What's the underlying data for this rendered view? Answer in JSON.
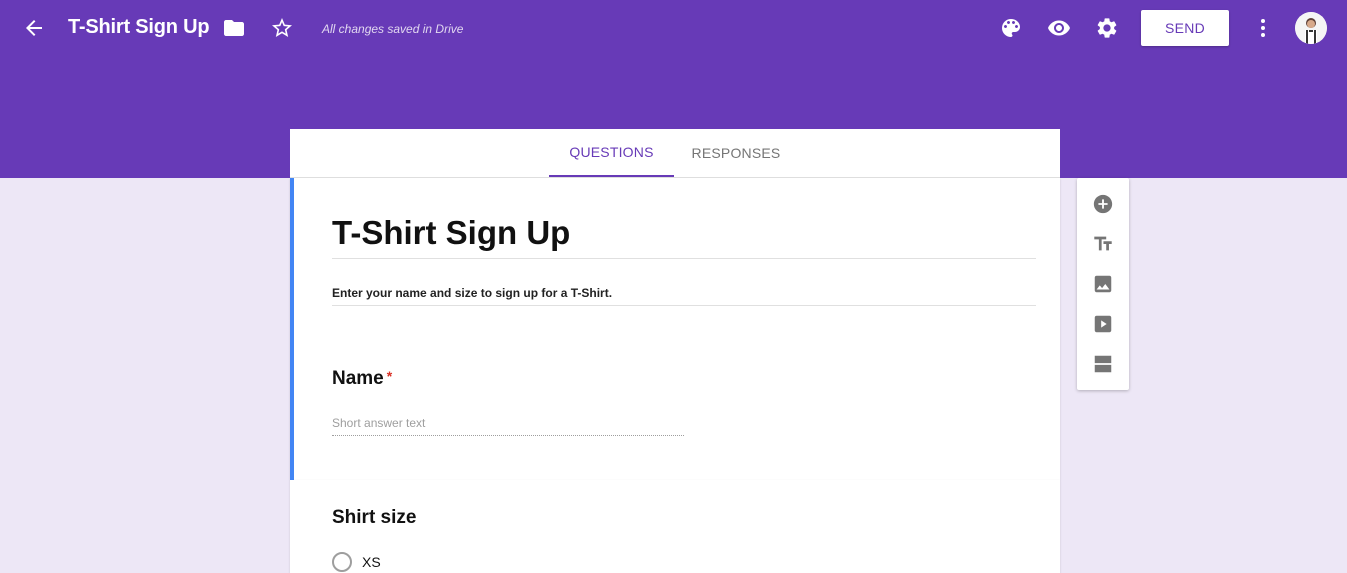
{
  "header": {
    "title": "T-Shirt Sign Up",
    "save_status": "All changes saved in Drive",
    "send_label": "SEND",
    "theme_color": "#673ab7",
    "icons": [
      "back-arrow-icon",
      "folder-icon",
      "star-icon",
      "palette-icon",
      "eye-icon",
      "gear-icon",
      "more-vert-icon"
    ]
  },
  "tabs": [
    {
      "label": "QUESTIONS",
      "active": true
    },
    {
      "label": "RESPONSES",
      "active": false
    }
  ],
  "form": {
    "title": "T-Shirt Sign Up",
    "description": "Enter your name and size to sign up for a T-Shirt."
  },
  "questions": [
    {
      "title": "Name",
      "required_mark": "*",
      "placeholder": "Short answer text"
    },
    {
      "title": "Shirt size",
      "options": [
        "XS"
      ]
    }
  ],
  "side_toolbar": {
    "icons": [
      "add-question-icon",
      "add-title-icon",
      "add-image-icon",
      "add-video-icon",
      "add-section-icon"
    ]
  }
}
